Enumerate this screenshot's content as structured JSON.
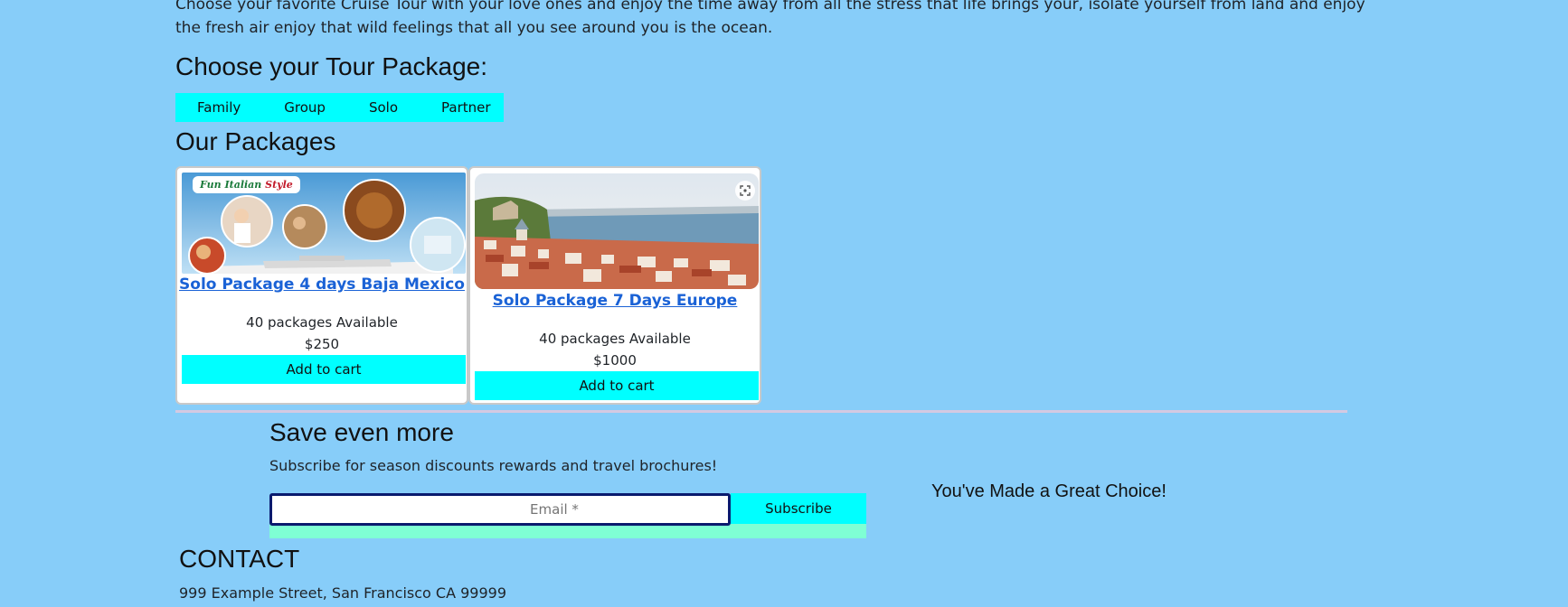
{
  "intro": {
    "text": "Choose your favorite Cruise Tour with your love ones and enjoy the time away from all the stress that life brings your, isolate yourself from land and enjoy the fresh air enjoy that wild feelings that all you see around you is the ocean."
  },
  "choose_section": {
    "heading": "Choose your Tour Package:",
    "tabs": [
      {
        "label": "Family"
      },
      {
        "label": "Group"
      },
      {
        "label": "Solo"
      },
      {
        "label": "Partner"
      }
    ]
  },
  "packages": {
    "heading": "Our Packages",
    "items": [
      {
        "title": "Solo Package 4 days Baja Mexico",
        "availability": "40 packages Available",
        "price": "$250",
        "button_label": "Add to cart",
        "image_logo": {
          "word1": "Fun",
          "word2": "Italian",
          "word3": "Style"
        }
      },
      {
        "title": "Solo Package 7 Days Europe",
        "availability": "40 packages Available",
        "price": "$1000",
        "button_label": "Add to cart"
      }
    ]
  },
  "newsletter": {
    "heading": "Save even more",
    "subtitle": "Subscribe for season discounts rewards and travel brochures!",
    "email_placeholder": "Email *",
    "email_value": "",
    "button_label": "Subscribe"
  },
  "side_message": "You've Made a Great Choice!",
  "contact": {
    "heading": "CONTACT",
    "address": "999 Example Street, San Francisco CA 99999"
  },
  "colors": {
    "page_background": "#87cdf9",
    "accent_cyan": "#00ffff",
    "link_blue": "#1a62d6",
    "strip_aquamarine": "#7fffd4",
    "divider": "#d4c9e2"
  }
}
